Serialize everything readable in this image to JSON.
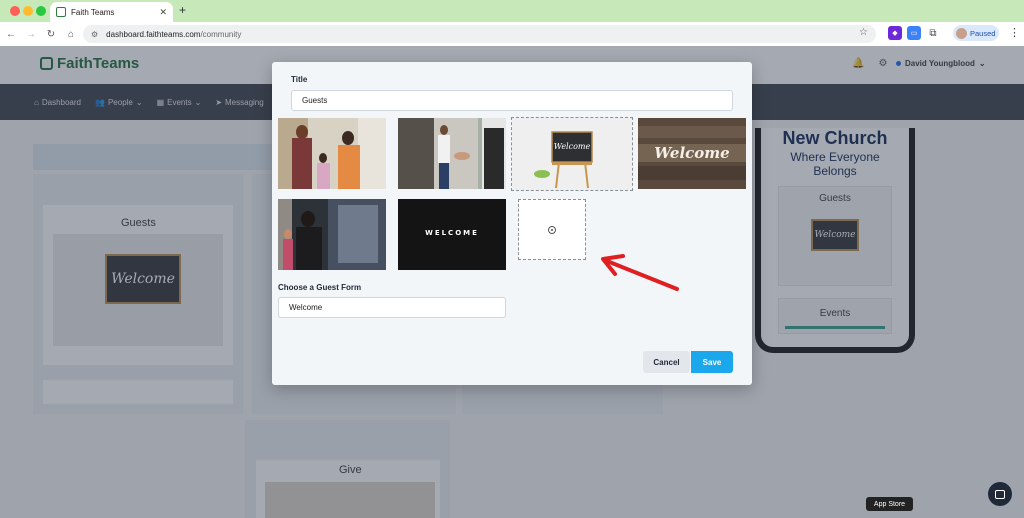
{
  "browser": {
    "tab_title": "Faith Teams",
    "url_host": "dashboard.faithteams.com",
    "url_path": "/community",
    "profile_status": "Paused",
    "colors": {
      "chrome_bg": "#c7e8b8",
      "close_dot": "#ff5f57",
      "min_dot": "#febc2e",
      "max_dot": "#28c840"
    }
  },
  "app": {
    "brand": "FaithTeams",
    "user_name": "David Youngblood",
    "nav": [
      "Dashboard",
      "People",
      "Events",
      "Messaging"
    ],
    "cards": {
      "guests_title": "Guests",
      "give_title": "Give",
      "welcome_sign": "Welcome"
    },
    "phone": {
      "headline": "New Church",
      "subline": "Where Everyone Belongs",
      "section1": "Guests",
      "section2": "Events",
      "sign": "Welcome"
    },
    "app_store_tooltip": "App Store"
  },
  "modal": {
    "title_label": "Title",
    "title_value": "Guests",
    "images": [
      {
        "name": "family-greeting-photo",
        "selected": false
      },
      {
        "name": "handshake-photo",
        "selected": false
      },
      {
        "name": "welcome-easel-photo",
        "selected": true,
        "sign": "Welcome"
      },
      {
        "name": "welcome-wood-sign-photo",
        "selected": false,
        "sign": "Welcome"
      },
      {
        "name": "greeter-doorway-photo",
        "selected": false
      },
      {
        "name": "welcome-letterboard-photo",
        "selected": false,
        "sign": "WELCOME"
      }
    ],
    "form_label": "Choose a Guest Form",
    "form_value": "Welcome",
    "cancel_label": "Cancel",
    "save_label": "Save",
    "accent_color": "#1aa7ec"
  },
  "annotation": {
    "arrow_color": "#e02020"
  }
}
